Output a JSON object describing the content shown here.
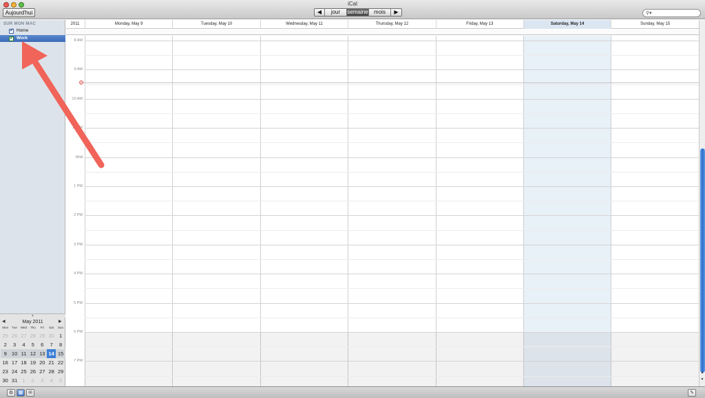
{
  "window": {
    "title": "iCal"
  },
  "toolbar": {
    "today_label": "Aujourd'hui",
    "prev_symbol": "◀",
    "next_symbol": "▶",
    "views": [
      "jour",
      "semaine",
      "mois"
    ],
    "active_view": "semaine",
    "search_icon": "search-icon"
  },
  "sidebar": {
    "header": "SUR MON MAC",
    "calendars": [
      {
        "label": "Home",
        "checked": true,
        "selected": false
      },
      {
        "label": "Work",
        "checked": true,
        "selected": true
      }
    ]
  },
  "minical": {
    "title": "May 2011",
    "prev_symbol": "◀",
    "next_symbol": "▶",
    "weekdays": [
      "Mon",
      "Tue",
      "Wed",
      "Thu",
      "Fri",
      "Sat",
      "Sun"
    ],
    "weeks": [
      [
        "25",
        "26",
        "27",
        "28",
        "29",
        "30",
        "1"
      ],
      [
        "2",
        "3",
        "4",
        "5",
        "6",
        "7",
        "8"
      ],
      [
        "9",
        "10",
        "11",
        "12",
        "13",
        "14",
        "15"
      ],
      [
        "16",
        "17",
        "18",
        "19",
        "20",
        "21",
        "22"
      ],
      [
        "23",
        "24",
        "25",
        "26",
        "27",
        "28",
        "29"
      ],
      [
        "30",
        "31",
        "1",
        "2",
        "3",
        "4",
        "5"
      ]
    ],
    "selected_day": "14"
  },
  "week": {
    "year": "2011",
    "days": [
      "Monday, May 9",
      "Tuesday, May 10",
      "Wednesday, May 11",
      "Thursday, May 12",
      "Friday, May 13",
      "Saturday, May 14",
      "Sunday, May 15"
    ],
    "today": "Saturday, May 14",
    "hours": [
      "8 AM",
      "9 AM",
      "10 AM",
      "11 AM",
      "Midi",
      "1 PM",
      "2 PM",
      "3 PM",
      "4 PM",
      "5 PM",
      "6 PM",
      "7 PM"
    ]
  },
  "colors": {
    "accent_blue": "#3d7fd6",
    "annotation_arrow": "#f0645a",
    "today_column": "#dbe6f2"
  }
}
